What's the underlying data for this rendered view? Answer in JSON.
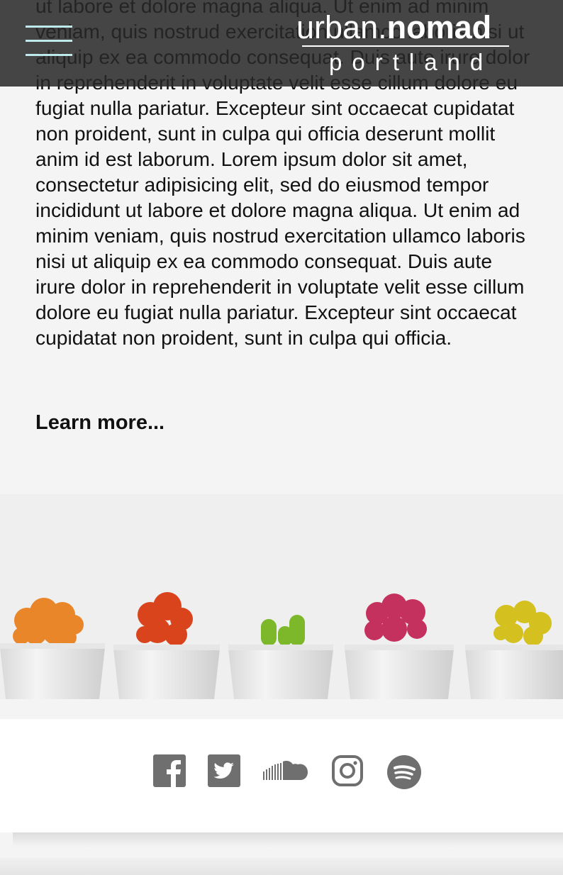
{
  "article": {
    "body": "ut labore et dolore magna aliqua. Ut enim ad minim veniam, quis nostrud exercitation ullamco laboris nisi ut aliquip ex ea commodo consequat. Duis aute irure dolor in reprehenderit in voluptate velit esse cillum dolore eu fugiat nulla pariatur. Excepteur sint occaecat cupidatat non proident, sunt in culpa qui officia deserunt mollit anim id est laborum. Lorem ipsum dolor sit amet, consectetur adipisicing elit, sed do eiusmod tempor incididunt ut labore et dolore magna aliqua. Ut enim ad minim veniam, quis nostrud exercitation ullamco laboris nisi ut aliquip ex ea commodo consequat. Duis aute irure dolor in reprehenderit in voluptate velit esse cillum dolore eu fugiat nulla pariatur. Excepteur sint occaecat cupidatat non proident, sunt in culpa qui officia.",
    "learn_more": "Learn more..."
  },
  "header": {
    "logo_light": "urban.",
    "logo_bold": "nomad",
    "logo_sub": "portland",
    "menu_icon": "hamburger-icon"
  },
  "colors": {
    "header_bg": "#282828",
    "menu_accent": "#bfe8ea",
    "icon_gray": "#6f6f6f"
  },
  "footer": {
    "social": [
      "facebook-icon",
      "twitter-icon",
      "soundcloud-icon",
      "instagram-icon",
      "spotify-icon"
    ]
  }
}
